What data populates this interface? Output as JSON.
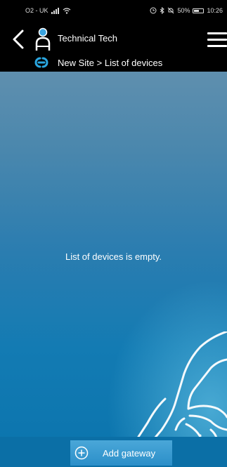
{
  "status_bar": {
    "carrier": "O2 - UK",
    "battery_percent": "50%",
    "time": "10:26"
  },
  "header": {
    "user_name": "Technical Tech",
    "breadcrumb": "New Site > List of devices"
  },
  "main": {
    "empty_message": "List of devices is empty."
  },
  "bottom": {
    "add_gateway_label": "Add gateway"
  },
  "icons": {
    "back": "chevron-left-icon",
    "user": "user-icon",
    "menu": "hamburger-menu-icon",
    "site": "link-icon",
    "add": "plus-circle-icon"
  },
  "colors": {
    "accent": "#2b8fc9",
    "header_bg": "#000000",
    "site_icon": "#2aa6e0",
    "user_badge": "#3aa4e0"
  }
}
